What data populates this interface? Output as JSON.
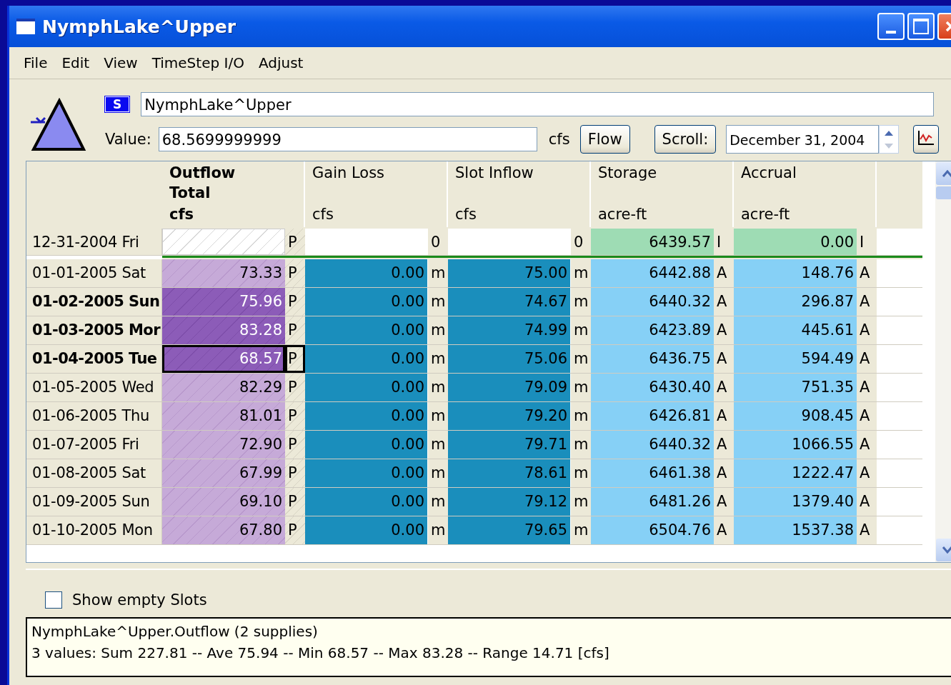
{
  "window": {
    "title": "NymphLake^Upper"
  },
  "menu": [
    "File",
    "Edit",
    "View",
    "TimeStep I/O",
    "Adjust"
  ],
  "header": {
    "badge": "S",
    "name": "NymphLake^Upper",
    "value_label": "Value:",
    "value": "68.5699999999",
    "unit": "cfs",
    "unit_button": "Flow",
    "scroll_button": "Scroll:",
    "date": "December 31, 2004"
  },
  "columns": [
    {
      "title": [
        "Outflow",
        "Total"
      ],
      "unit": "cfs",
      "bold": true,
      "kind": "outflow"
    },
    {
      "title": [
        "Gain Loss"
      ],
      "unit": "cfs",
      "bold": false,
      "kind": "flow"
    },
    {
      "title": [
        "Slot Inflow"
      ],
      "unit": "cfs",
      "bold": false,
      "kind": "flow"
    },
    {
      "title": [
        "Storage"
      ],
      "unit": "acre-ft",
      "bold": false,
      "kind": "volume"
    },
    {
      "title": [
        "Accrual"
      ],
      "unit": "acre-ft",
      "bold": false,
      "kind": "volume"
    }
  ],
  "initial_row": {
    "date": "12-31-2004 Fri",
    "cells": [
      {
        "flag": "P"
      },
      {
        "flag": "0"
      },
      {
        "flag": "0"
      },
      {
        "value": "6439.57",
        "flag": "I"
      },
      {
        "value": "0.00",
        "flag": "I"
      }
    ]
  },
  "rows": [
    {
      "date": "01-01-2005 Sat",
      "selected": false,
      "focused": false,
      "cells": [
        {
          "value": "73.33",
          "flag": "P"
        },
        {
          "value": "0.00",
          "flag": "m"
        },
        {
          "value": "75.00",
          "flag": "m"
        },
        {
          "value": "6442.88",
          "flag": "A"
        },
        {
          "value": "148.76",
          "flag": "A"
        }
      ]
    },
    {
      "date": "01-02-2005 Sun",
      "selected": true,
      "focused": false,
      "cells": [
        {
          "value": "75.96",
          "flag": "P"
        },
        {
          "value": "0.00",
          "flag": "m"
        },
        {
          "value": "74.67",
          "flag": "m"
        },
        {
          "value": "6440.32",
          "flag": "A"
        },
        {
          "value": "296.87",
          "flag": "A"
        }
      ]
    },
    {
      "date": "01-03-2005 Mor",
      "selected": true,
      "focused": false,
      "cells": [
        {
          "value": "83.28",
          "flag": "P"
        },
        {
          "value": "0.00",
          "flag": "m"
        },
        {
          "value": "74.99",
          "flag": "m"
        },
        {
          "value": "6423.89",
          "flag": "A"
        },
        {
          "value": "445.61",
          "flag": "A"
        }
      ]
    },
    {
      "date": "01-04-2005 Tue",
      "selected": true,
      "focused": true,
      "cells": [
        {
          "value": "68.57",
          "flag": "P"
        },
        {
          "value": "0.00",
          "flag": "m"
        },
        {
          "value": "75.06",
          "flag": "m"
        },
        {
          "value": "6436.75",
          "flag": "A"
        },
        {
          "value": "594.49",
          "flag": "A"
        }
      ]
    },
    {
      "date": "01-05-2005 Wed",
      "selected": false,
      "focused": false,
      "cells": [
        {
          "value": "82.29",
          "flag": "P"
        },
        {
          "value": "0.00",
          "flag": "m"
        },
        {
          "value": "79.09",
          "flag": "m"
        },
        {
          "value": "6430.40",
          "flag": "A"
        },
        {
          "value": "751.35",
          "flag": "A"
        }
      ]
    },
    {
      "date": "01-06-2005 Thu",
      "selected": false,
      "focused": false,
      "cells": [
        {
          "value": "81.01",
          "flag": "P"
        },
        {
          "value": "0.00",
          "flag": "m"
        },
        {
          "value": "79.20",
          "flag": "m"
        },
        {
          "value": "6426.81",
          "flag": "A"
        },
        {
          "value": "908.45",
          "flag": "A"
        }
      ]
    },
    {
      "date": "01-07-2005 Fri",
      "selected": false,
      "focused": false,
      "cells": [
        {
          "value": "72.90",
          "flag": "P"
        },
        {
          "value": "0.00",
          "flag": "m"
        },
        {
          "value": "79.71",
          "flag": "m"
        },
        {
          "value": "6440.32",
          "flag": "A"
        },
        {
          "value": "1066.55",
          "flag": "A"
        }
      ]
    },
    {
      "date": "01-08-2005 Sat",
      "selected": false,
      "focused": false,
      "cells": [
        {
          "value": "67.99",
          "flag": "P"
        },
        {
          "value": "0.00",
          "flag": "m"
        },
        {
          "value": "78.61",
          "flag": "m"
        },
        {
          "value": "6461.38",
          "flag": "A"
        },
        {
          "value": "1222.47",
          "flag": "A"
        }
      ]
    },
    {
      "date": "01-09-2005 Sun",
      "selected": false,
      "focused": false,
      "cells": [
        {
          "value": "69.10",
          "flag": "P"
        },
        {
          "value": "0.00",
          "flag": "m"
        },
        {
          "value": "79.12",
          "flag": "m"
        },
        {
          "value": "6481.26",
          "flag": "A"
        },
        {
          "value": "1379.40",
          "flag": "A"
        }
      ]
    },
    {
      "date": "01-10-2005 Mon",
      "selected": false,
      "focused": false,
      "cells": [
        {
          "value": "67.80",
          "flag": "P"
        },
        {
          "value": "0.00",
          "flag": "m"
        },
        {
          "value": "79.65",
          "flag": "m"
        },
        {
          "value": "6504.76",
          "flag": "A"
        },
        {
          "value": "1537.38",
          "flag": "A"
        }
      ]
    }
  ],
  "show_empty_slots": {
    "label": "Show empty Slots",
    "checked": false
  },
  "info": [
    "NymphLake^Upper.Outflow (2 supplies)",
    "3 values:  Sum 227.81 -- Ave 75.94 -- Min 68.57 -- Max 83.28 -- Range 14.71 [cfs]"
  ]
}
